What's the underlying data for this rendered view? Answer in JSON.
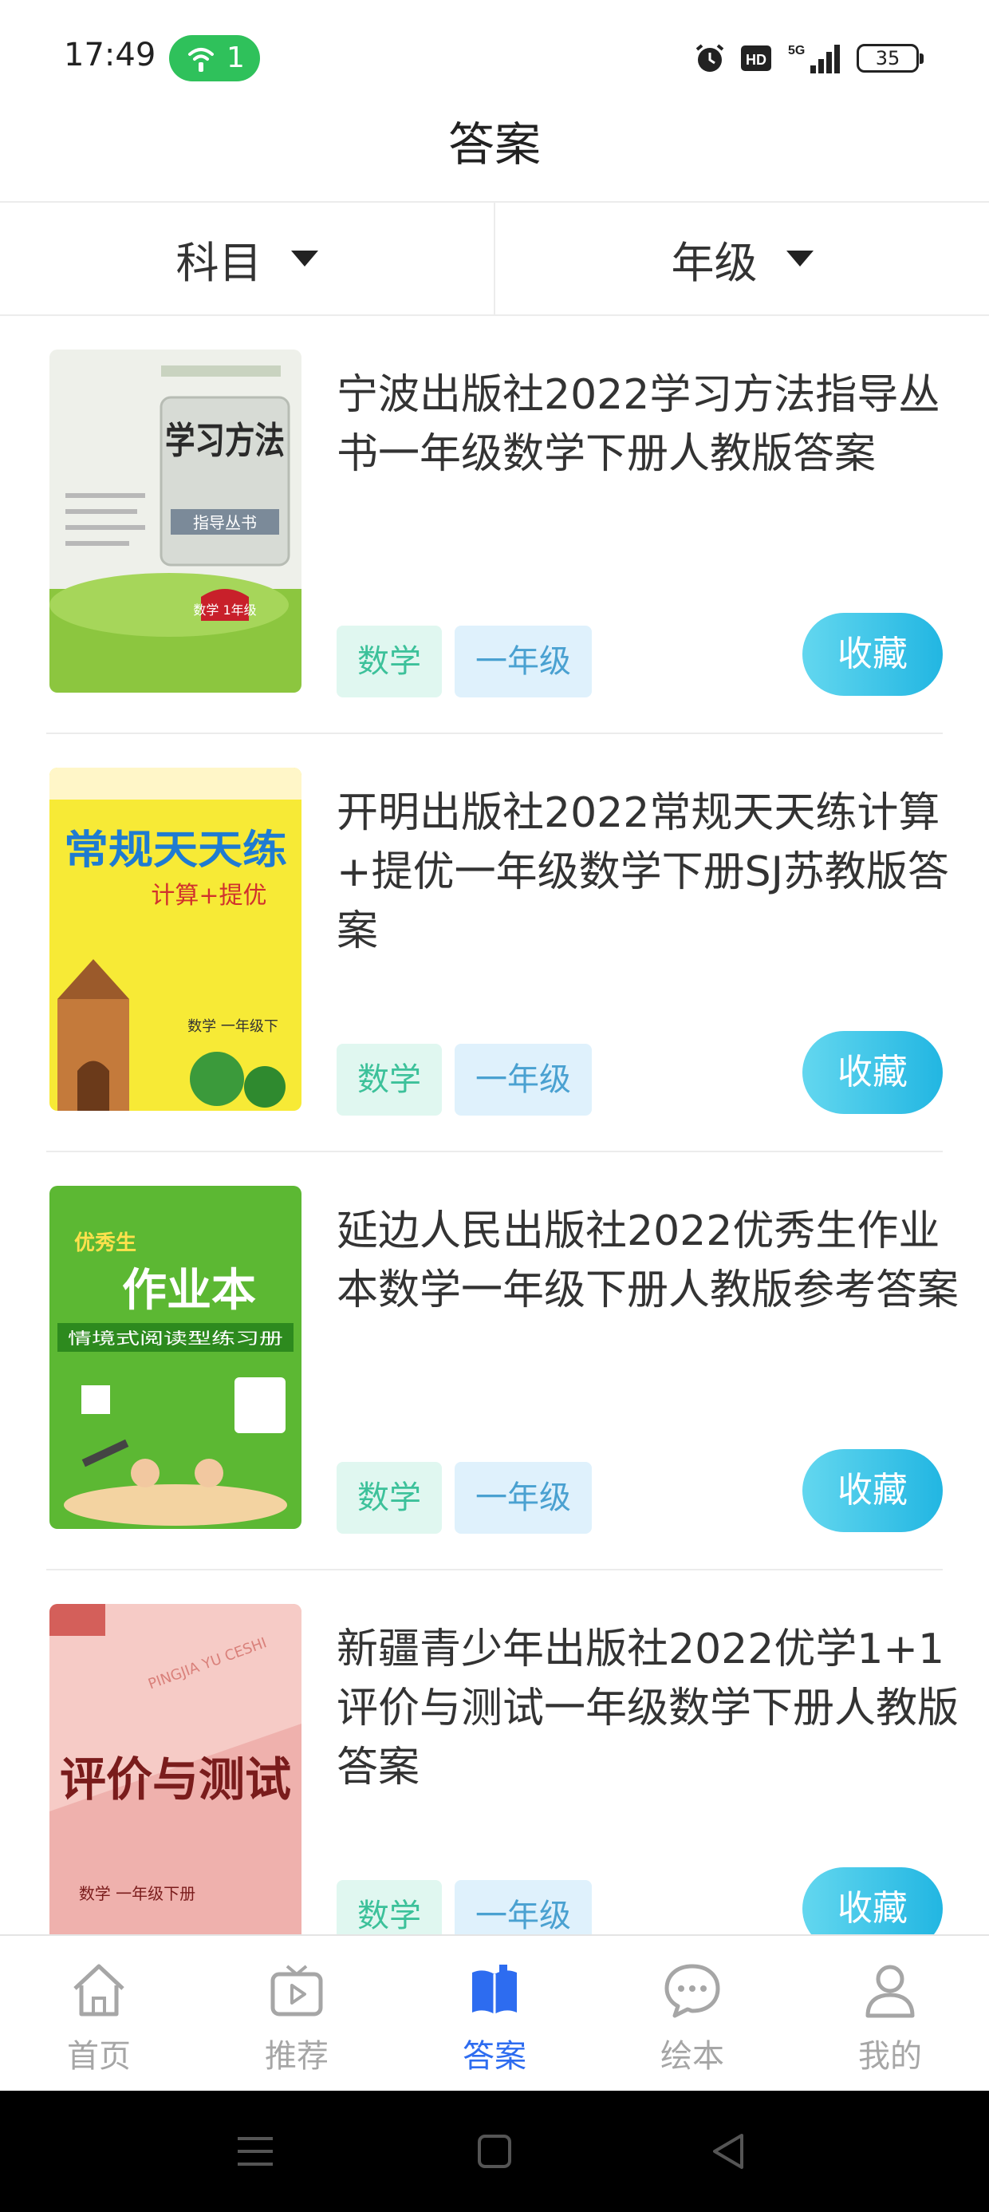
{
  "status_bar": {
    "time": "17:49",
    "hotspot_count": "1",
    "network": "5G",
    "battery": "35",
    "icons": [
      "wifi-hotspot-icon",
      "alarm-icon",
      "hd-icon",
      "signal-5g-icon",
      "battery-icon"
    ]
  },
  "header": {
    "title": "答案"
  },
  "filters": [
    {
      "label": "科目",
      "icon": "dropdown-triangle-icon"
    },
    {
      "label": "年级",
      "icon": "dropdown-triangle-icon"
    }
  ],
  "items": [
    {
      "title": "宁波出版社2022学习方法指导丛书一年级数学下册人教版答案",
      "subject": "数学",
      "grade": "一年级",
      "favorite_label": "收藏",
      "cover": {
        "text": "学习方法",
        "sub": "指导丛书",
        "badge": "数学 1年级"
      }
    },
    {
      "title": "开明出版社2022常规天天练计算+提优一年级数学下册SJ苏教版答案",
      "subject": "数学",
      "grade": "一年级",
      "favorite_label": "收藏",
      "cover": {
        "text": "常规天天练",
        "sub": "计算+提优",
        "badge": "数学 一年级下"
      }
    },
    {
      "title": "延边人民出版社2022优秀生作业本数学一年级下册人教版参考答案",
      "subject": "数学",
      "grade": "一年级",
      "favorite_label": "收藏",
      "cover": {
        "text": "作业本",
        "sub": "情境式阅读型练习册",
        "badge": "优秀生"
      }
    },
    {
      "title": "新疆青少年出版社2022优学1+1评价与测试一年级数学下册人教版答案",
      "subject": "数学",
      "grade": "一年级",
      "favorite_label": "收藏",
      "cover": {
        "text": "评价与测试",
        "sub": "PINGJIA YU CESHI",
        "badge": "数学 一年级下册"
      }
    }
  ],
  "bottom_nav": [
    {
      "label": "首页",
      "icon": "home-icon",
      "active": false
    },
    {
      "label": "推荐",
      "icon": "tv-play-icon",
      "active": false
    },
    {
      "label": "答案",
      "icon": "book-icon",
      "active": true
    },
    {
      "label": "绘本",
      "icon": "chat-bubble-icon",
      "active": false
    },
    {
      "label": "我的",
      "icon": "user-icon",
      "active": false
    }
  ],
  "colors": {
    "accent": "#2d6cf0",
    "favorite_button": "#22b6e2",
    "tag_subject_bg": "#e0f7f0",
    "tag_grade_bg": "#dff1fc"
  }
}
